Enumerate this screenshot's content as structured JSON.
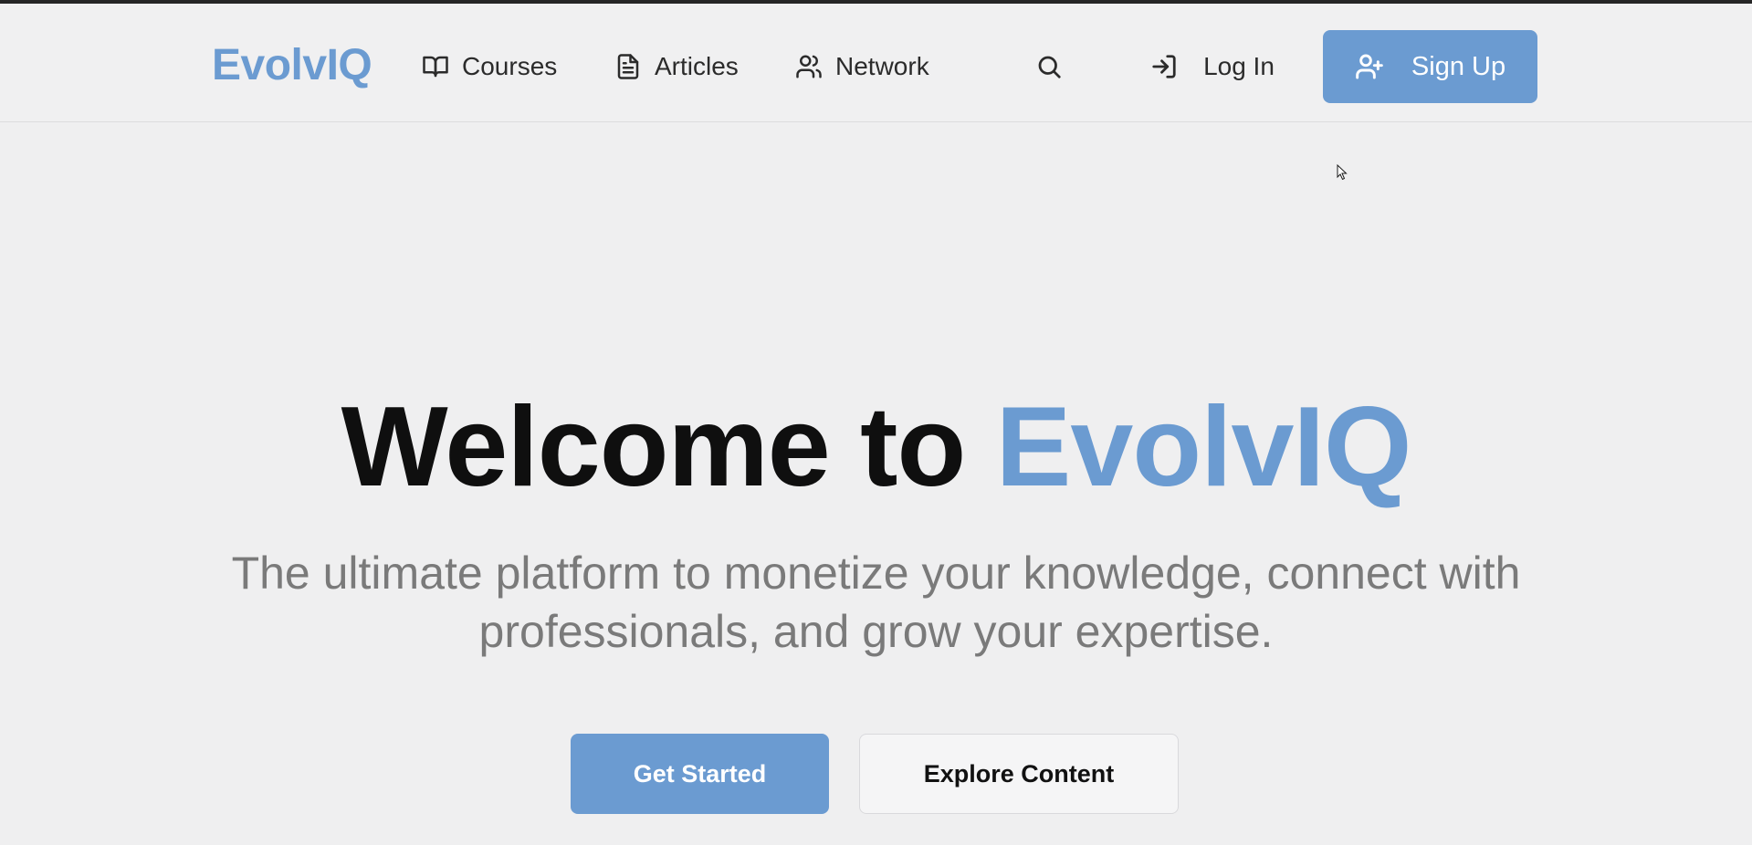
{
  "nav": {
    "logo": "EvolvIQ",
    "items": [
      {
        "label": "Courses",
        "icon": "book-open-icon"
      },
      {
        "label": "Articles",
        "icon": "file-text-icon"
      },
      {
        "label": "Network",
        "icon": "users-icon"
      }
    ],
    "search_icon": "search-icon",
    "login_label": "Log In",
    "login_icon": "log-in-icon",
    "signup_label": "Sign Up",
    "signup_icon": "user-plus-icon"
  },
  "hero": {
    "title_prefix": "Welcome to ",
    "title_accent": "EvolvIQ",
    "subtitle": "The ultimate platform to monetize your knowledge, connect with professionals, and grow your expertise.",
    "primary_cta": "Get Started",
    "secondary_cta": "Explore Content"
  },
  "colors": {
    "accent": "#6b9bd1",
    "background": "#efeff0",
    "text": "#0f0f0f",
    "muted_text": "#7a7a7a"
  }
}
